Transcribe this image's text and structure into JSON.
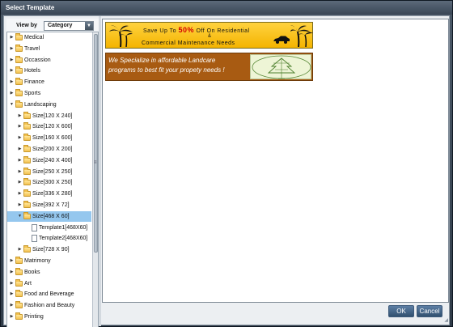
{
  "dialog": {
    "title": "Select Template",
    "ok_label": "OK",
    "cancel_label": "Cancel"
  },
  "view_by": {
    "label": "View by",
    "selected": "Category"
  },
  "tree": {
    "items": [
      {
        "label": "Medical",
        "expanded": false
      },
      {
        "label": "Travel",
        "expanded": false
      },
      {
        "label": "Occassion",
        "expanded": false
      },
      {
        "label": "Hotels",
        "expanded": false
      },
      {
        "label": "Finance",
        "expanded": false
      },
      {
        "label": "Sports",
        "expanded": false
      },
      {
        "label": "Landscaping",
        "expanded": true
      },
      {
        "label": "Size[120 X 240]",
        "expanded": false
      },
      {
        "label": "Size[120 X 600]",
        "expanded": false
      },
      {
        "label": "Size[160 X 600]",
        "expanded": false
      },
      {
        "label": "Size[200 X 200]",
        "expanded": false
      },
      {
        "label": "Size[240 X 400]",
        "expanded": false
      },
      {
        "label": "Size[250 X 250]",
        "expanded": false
      },
      {
        "label": "Size[300 X 250]",
        "expanded": false
      },
      {
        "label": "Size[336 X 280]",
        "expanded": false
      },
      {
        "label": "Size[392 X 72]",
        "expanded": false
      },
      {
        "label": "Size[468 X 60]",
        "expanded": true,
        "selected": true
      },
      {
        "label": "Template1[468X60]",
        "leaf": true
      },
      {
        "label": "Template2[468X60]",
        "leaf": true
      },
      {
        "label": "Size[728 X 90]",
        "expanded": false
      },
      {
        "label": "Matrimony",
        "expanded": false
      },
      {
        "label": "Books",
        "expanded": false
      },
      {
        "label": "Art",
        "expanded": false
      },
      {
        "label": "Food and Beverage",
        "expanded": false
      },
      {
        "label": "Fashion and Beauty",
        "expanded": false
      },
      {
        "label": "Printing",
        "expanded": false
      }
    ]
  },
  "preview": {
    "banner1": {
      "line1_pre": "Save Up To ",
      "line1_pct": "50%",
      "line1_post": " Off On Residential",
      "amp": "&",
      "line2": "Commercial Maintenance Needs"
    },
    "banner2": {
      "line1": "We Specialize in affordable Landcare",
      "line2": "programs to best fit your propety needs !"
    }
  },
  "colors": {
    "selection": "#95c7ee",
    "banner1_bg": "#f4b400",
    "banner2_bg": "#a85b12",
    "accent_red": "#d40000"
  }
}
